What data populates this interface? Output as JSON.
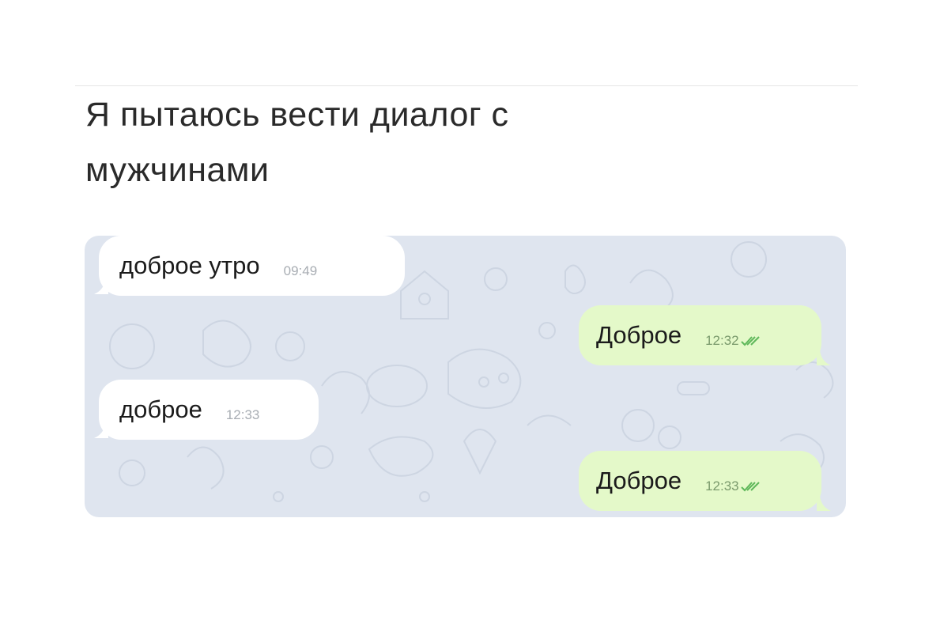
{
  "caption": {
    "line1": "Я пытаюсь вести диалог с",
    "line2": "мужчинами"
  },
  "messages": [
    {
      "direction": "in",
      "text": "доброе утро",
      "time": "09:49"
    },
    {
      "direction": "out",
      "text": "Доброе",
      "time": "12:32",
      "status": "read-double-check-icon"
    },
    {
      "direction": "in",
      "text": "доброе",
      "time": "12:33"
    },
    {
      "direction": "out",
      "text": "Доброе",
      "time": "12:33",
      "status": "read-double-check-icon"
    }
  ],
  "colors": {
    "chat_background": "#dfe5ef",
    "incoming_bubble": "#ffffff",
    "outgoing_bubble": "#e4f9c9",
    "read_checks": "#5fb85a"
  }
}
